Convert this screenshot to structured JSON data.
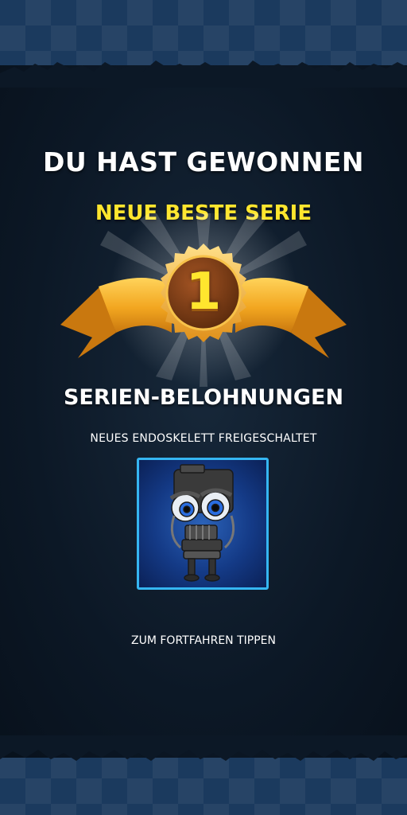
{
  "result": {
    "title": "DU HAST GEWONNEN",
    "subtitle": "NEUE BESTE SERIE",
    "rank": "1"
  },
  "rewards": {
    "heading": "SERIEN-BELOHNUNGEN",
    "unlock_text": "NEUES ENDOSKELETT FREIGESCHALTET",
    "item_icon": "endoskeleton-plush-icon"
  },
  "prompt": {
    "continue_text": "ZUM FORTFAHREN TIPPEN"
  },
  "colors": {
    "accent_yellow": "#ffe62e",
    "card_border": "#35b6f2",
    "ribbon_gold": "#f2a620",
    "medal_brown": "#7a3a12"
  }
}
